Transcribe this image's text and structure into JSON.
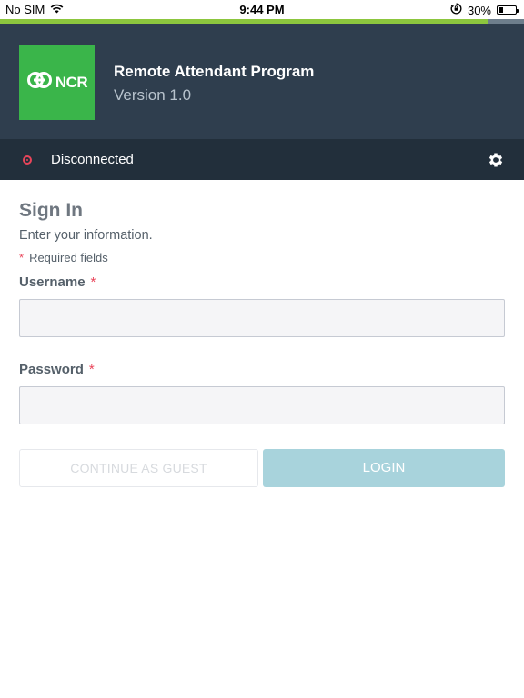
{
  "status_bar": {
    "carrier": "No SIM",
    "time": "9:44 PM",
    "battery_percent": "30%",
    "battery_level": 0.3,
    "wifi_icon": "wifi-icon",
    "rotation_lock_icon": "rotation-lock-icon"
  },
  "top_progress": {
    "fraction": 0.93,
    "fill_color": "#8cc63e"
  },
  "header": {
    "logo_text": "NCR",
    "logo_color": "#3ab54a",
    "title": "Remote Attendant Program",
    "version": "Version 1.0",
    "background": "#2f3e4e"
  },
  "connection": {
    "status": "Disconnected",
    "status_color": "#e9455a",
    "settings_icon": "gear-icon"
  },
  "form": {
    "title": "Sign In",
    "subtitle": "Enter your information.",
    "required_marker": "*",
    "required_note": "Required fields",
    "username_label": "Username",
    "username_value": "",
    "username_placeholder": "",
    "password_label": "Password",
    "password_value": "",
    "password_placeholder": ""
  },
  "buttons": {
    "guest_label": "CONTINUE AS GUEST",
    "login_label": "LOGIN",
    "login_color": "#a8d3dc"
  }
}
